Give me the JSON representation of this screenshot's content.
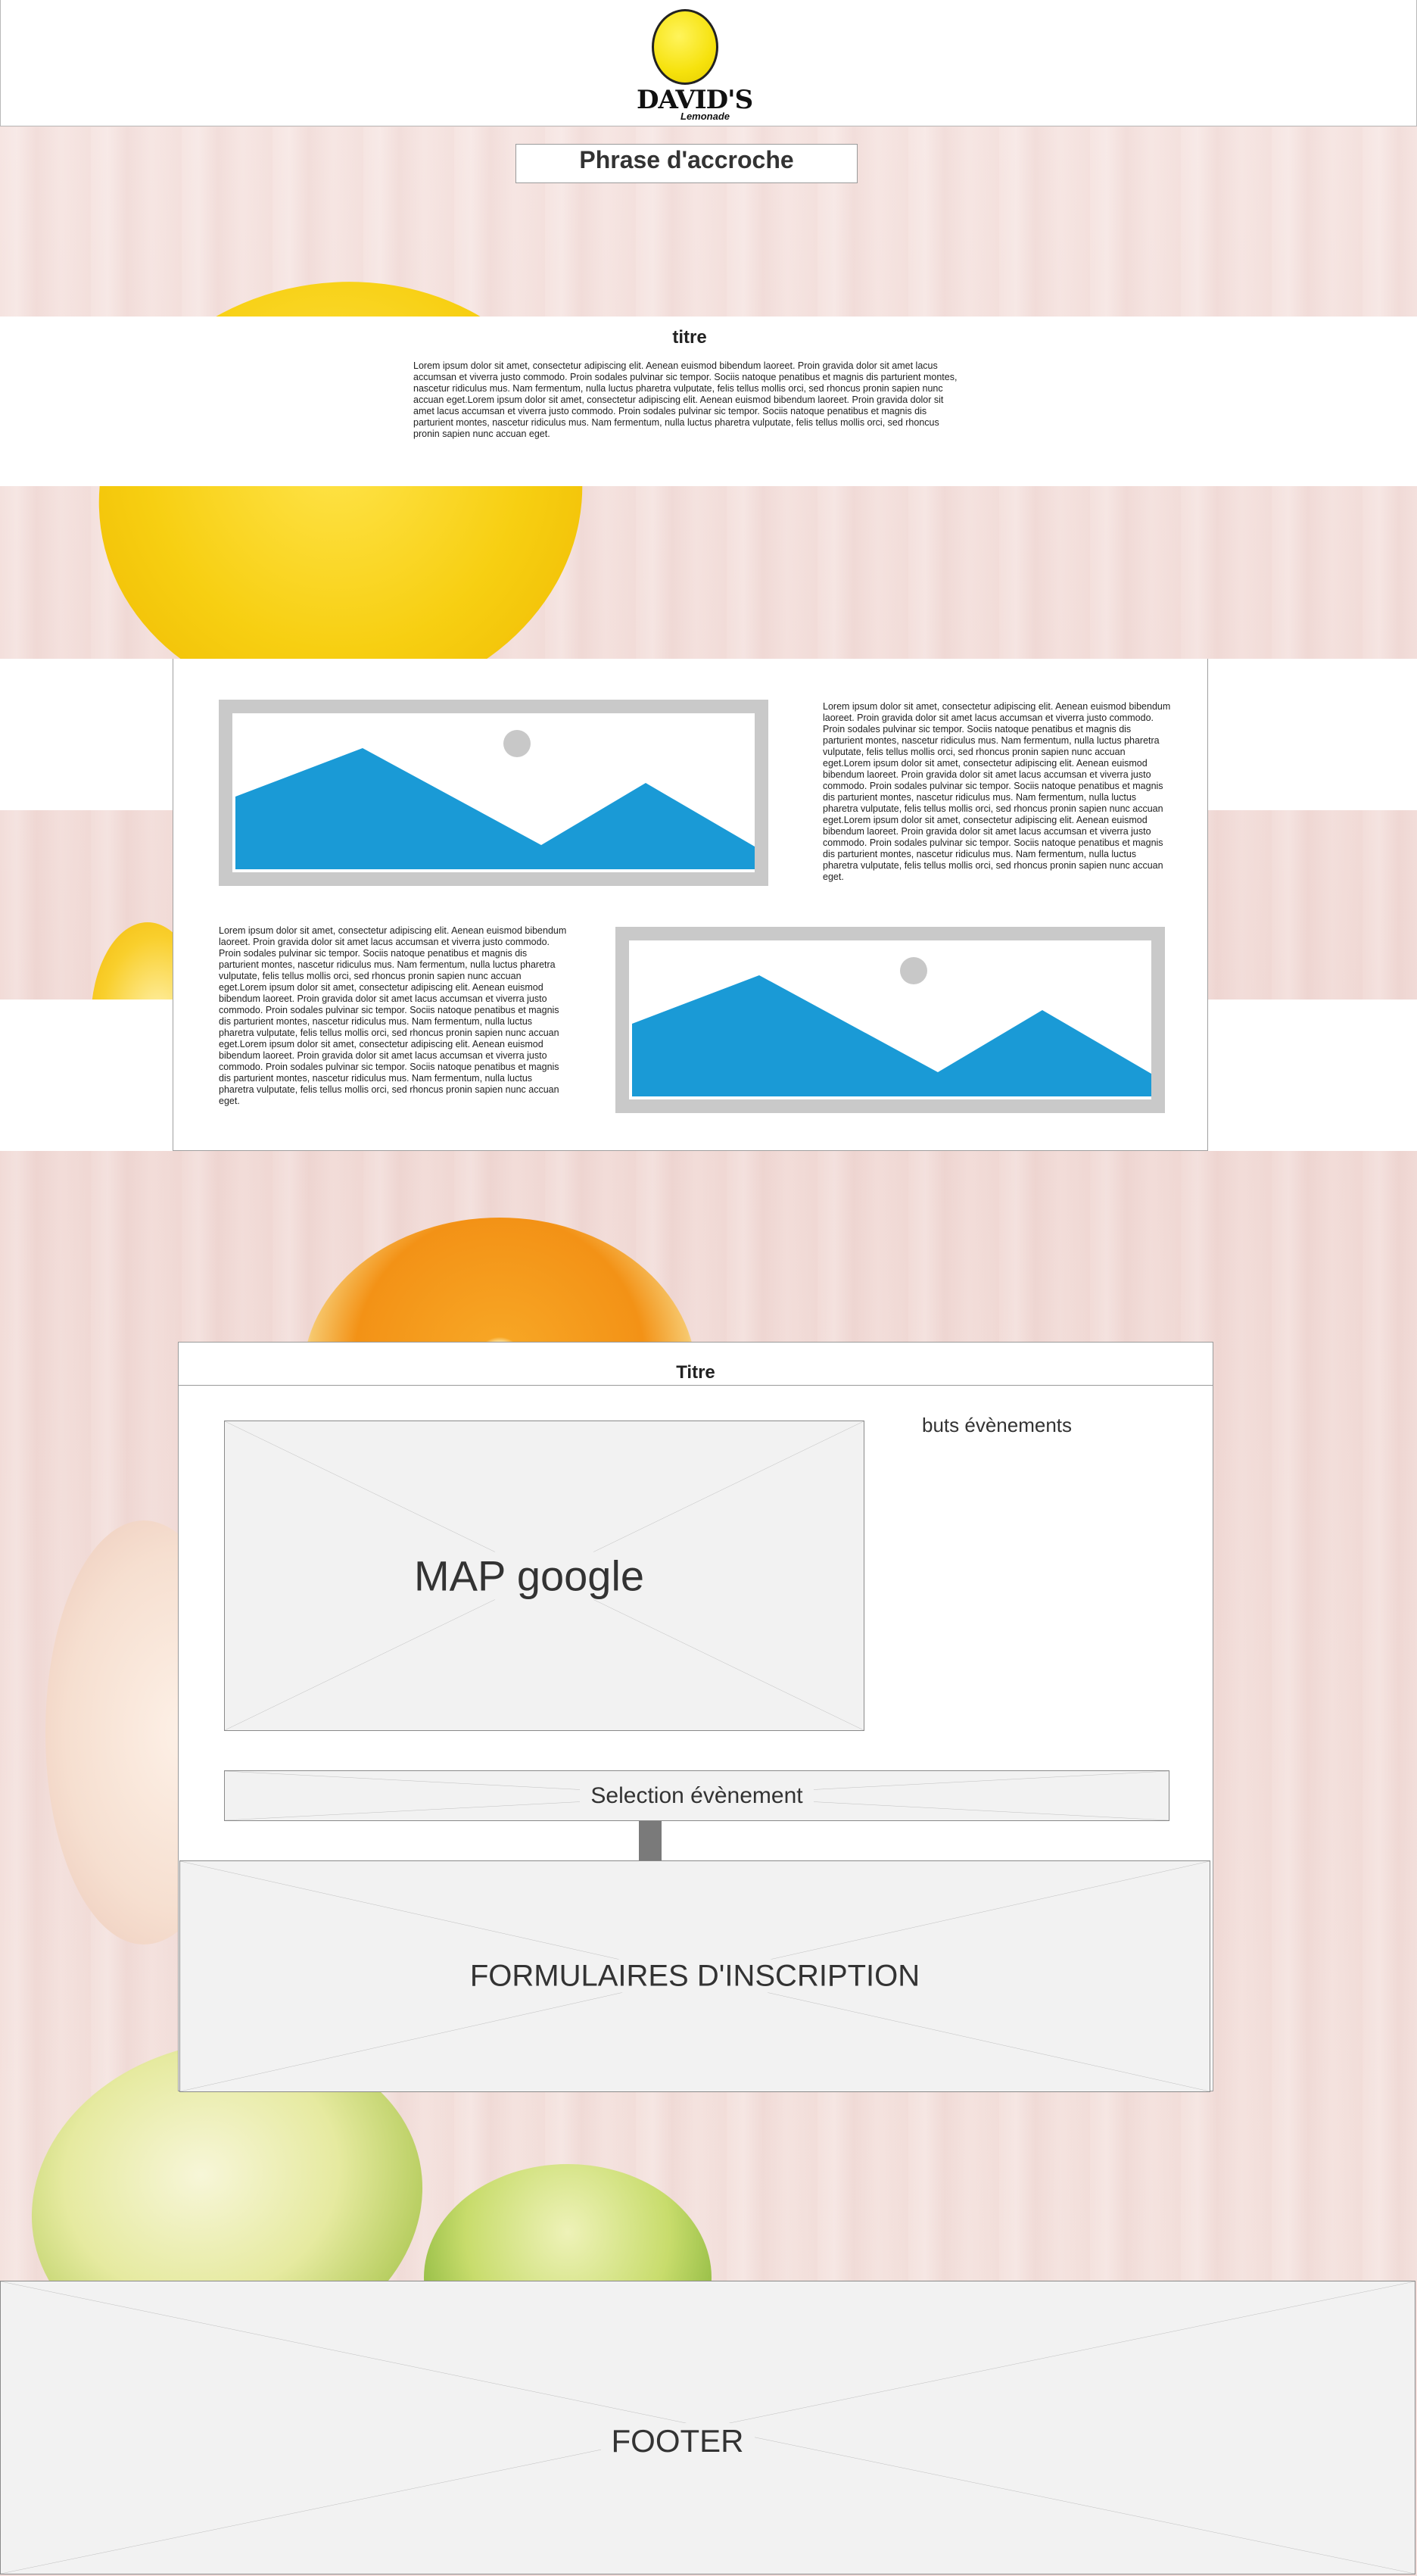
{
  "header": {
    "logo_text": "DAVID'S",
    "logo_subtext": "Lemonade"
  },
  "hero": {
    "tagline": "Phrase d'accroche"
  },
  "intro": {
    "title": "titre",
    "text": "Lorem ipsum dolor sit amet, consectetur adipiscing elit. Aenean euismod bibendum laoreet. Proin gravida dolor sit amet lacus accumsan et viverra justo commodo. Proin sodales pulvinar sic tempor. Sociis natoque penatibus et magnis dis parturient montes, nascetur ridiculus mus. Nam fermentum, nulla luctus pharetra vulputate, felis tellus mollis orci, sed rhoncus pronin sapien nunc accuan eget.Lorem ipsum dolor sit amet, consectetur adipiscing elit. Aenean euismod bibendum laoreet. Proin gravida dolor sit amet lacus accumsan et viverra justo commodo. Proin sodales pulvinar sic tempor. Sociis natoque penatibus et magnis dis parturient montes, nascetur ridiculus mus. Nam fermentum, nulla luctus pharetra vulputate, felis tellus mollis orci, sed rhoncus pronin sapien nunc accuan eget."
  },
  "content": {
    "text_right": "Lorem ipsum dolor sit amet, consectetur adipiscing elit. Aenean euismod bibendum laoreet. Proin gravida dolor sit amet lacus accumsan et viverra justo commodo. Proin sodales pulvinar sic tempor. Sociis natoque penatibus et magnis dis parturient montes, nascetur ridiculus mus. Nam fermentum, nulla luctus pharetra vulputate, felis tellus mollis orci, sed rhoncus pronin sapien nunc accuan eget.Lorem ipsum dolor sit amet, consectetur adipiscing elit. Aenean euismod bibendum laoreet. Proin gravida dolor sit amet lacus accumsan et viverra justo commodo. Proin sodales pulvinar sic tempor. Sociis natoque penatibus et magnis dis parturient montes, nascetur ridiculus mus. Nam fermentum, nulla luctus pharetra vulputate, felis tellus mollis orci, sed rhoncus pronin sapien nunc accuan eget.Lorem ipsum dolor sit amet, consectetur adipiscing elit. Aenean euismod bibendum laoreet. Proin gravida dolor sit amet lacus accumsan et viverra justo commodo. Proin sodales pulvinar sic tempor. Sociis natoque penatibus et magnis dis parturient montes, nascetur ridiculus mus. Nam fermentum, nulla luctus pharetra vulputate, felis tellus mollis orci, sed rhoncus pronin sapien nunc accuan eget.",
    "text_left": "Lorem ipsum dolor sit amet, consectetur adipiscing elit. Aenean euismod bibendum laoreet. Proin gravida dolor sit amet lacus accumsan et viverra justo commodo. Proin sodales pulvinar sic tempor. Sociis natoque penatibus et magnis dis parturient montes, nascetur ridiculus mus. Nam fermentum, nulla luctus pharetra vulputate, felis tellus mollis orci, sed rhoncus pronin sapien nunc accuan eget.Lorem ipsum dolor sit amet, consectetur adipiscing elit. Aenean euismod bibendum laoreet. Proin gravida dolor sit amet lacus accumsan et viverra justo commodo. Proin sodales pulvinar sic tempor. Sociis natoque penatibus et magnis dis parturient montes, nascetur ridiculus mus. Nam fermentum, nulla luctus pharetra vulputate, felis tellus mollis orci, sed rhoncus pronin sapien nunc accuan eget.Lorem ipsum dolor sit amet, consectetur adipiscing elit. Aenean euismod bibendum laoreet. Proin gravida dolor sit amet lacus accumsan et viverra justo commodo. Proin sodales pulvinar sic tempor. Sociis natoque penatibus et magnis dis parturient montes, nascetur ridiculus mus. Nam fermentum, nulla luctus pharetra vulputate, felis tellus mollis orci, sed rhoncus pronin sapien nunc accuan eget."
  },
  "events": {
    "title": "Titre",
    "map_label": "MAP google",
    "goals_label": "buts évènements",
    "select_label": "Selection évènement",
    "forms_label": "FORMULAIRES D'INSCRIPTION"
  },
  "footer": {
    "label": "FOOTER"
  },
  "colors": {
    "image_placeholder_blue": "#1a9ad6",
    "placeholder_gray": "#f2f2f2",
    "lemon_yellow": "#f6e20d"
  }
}
